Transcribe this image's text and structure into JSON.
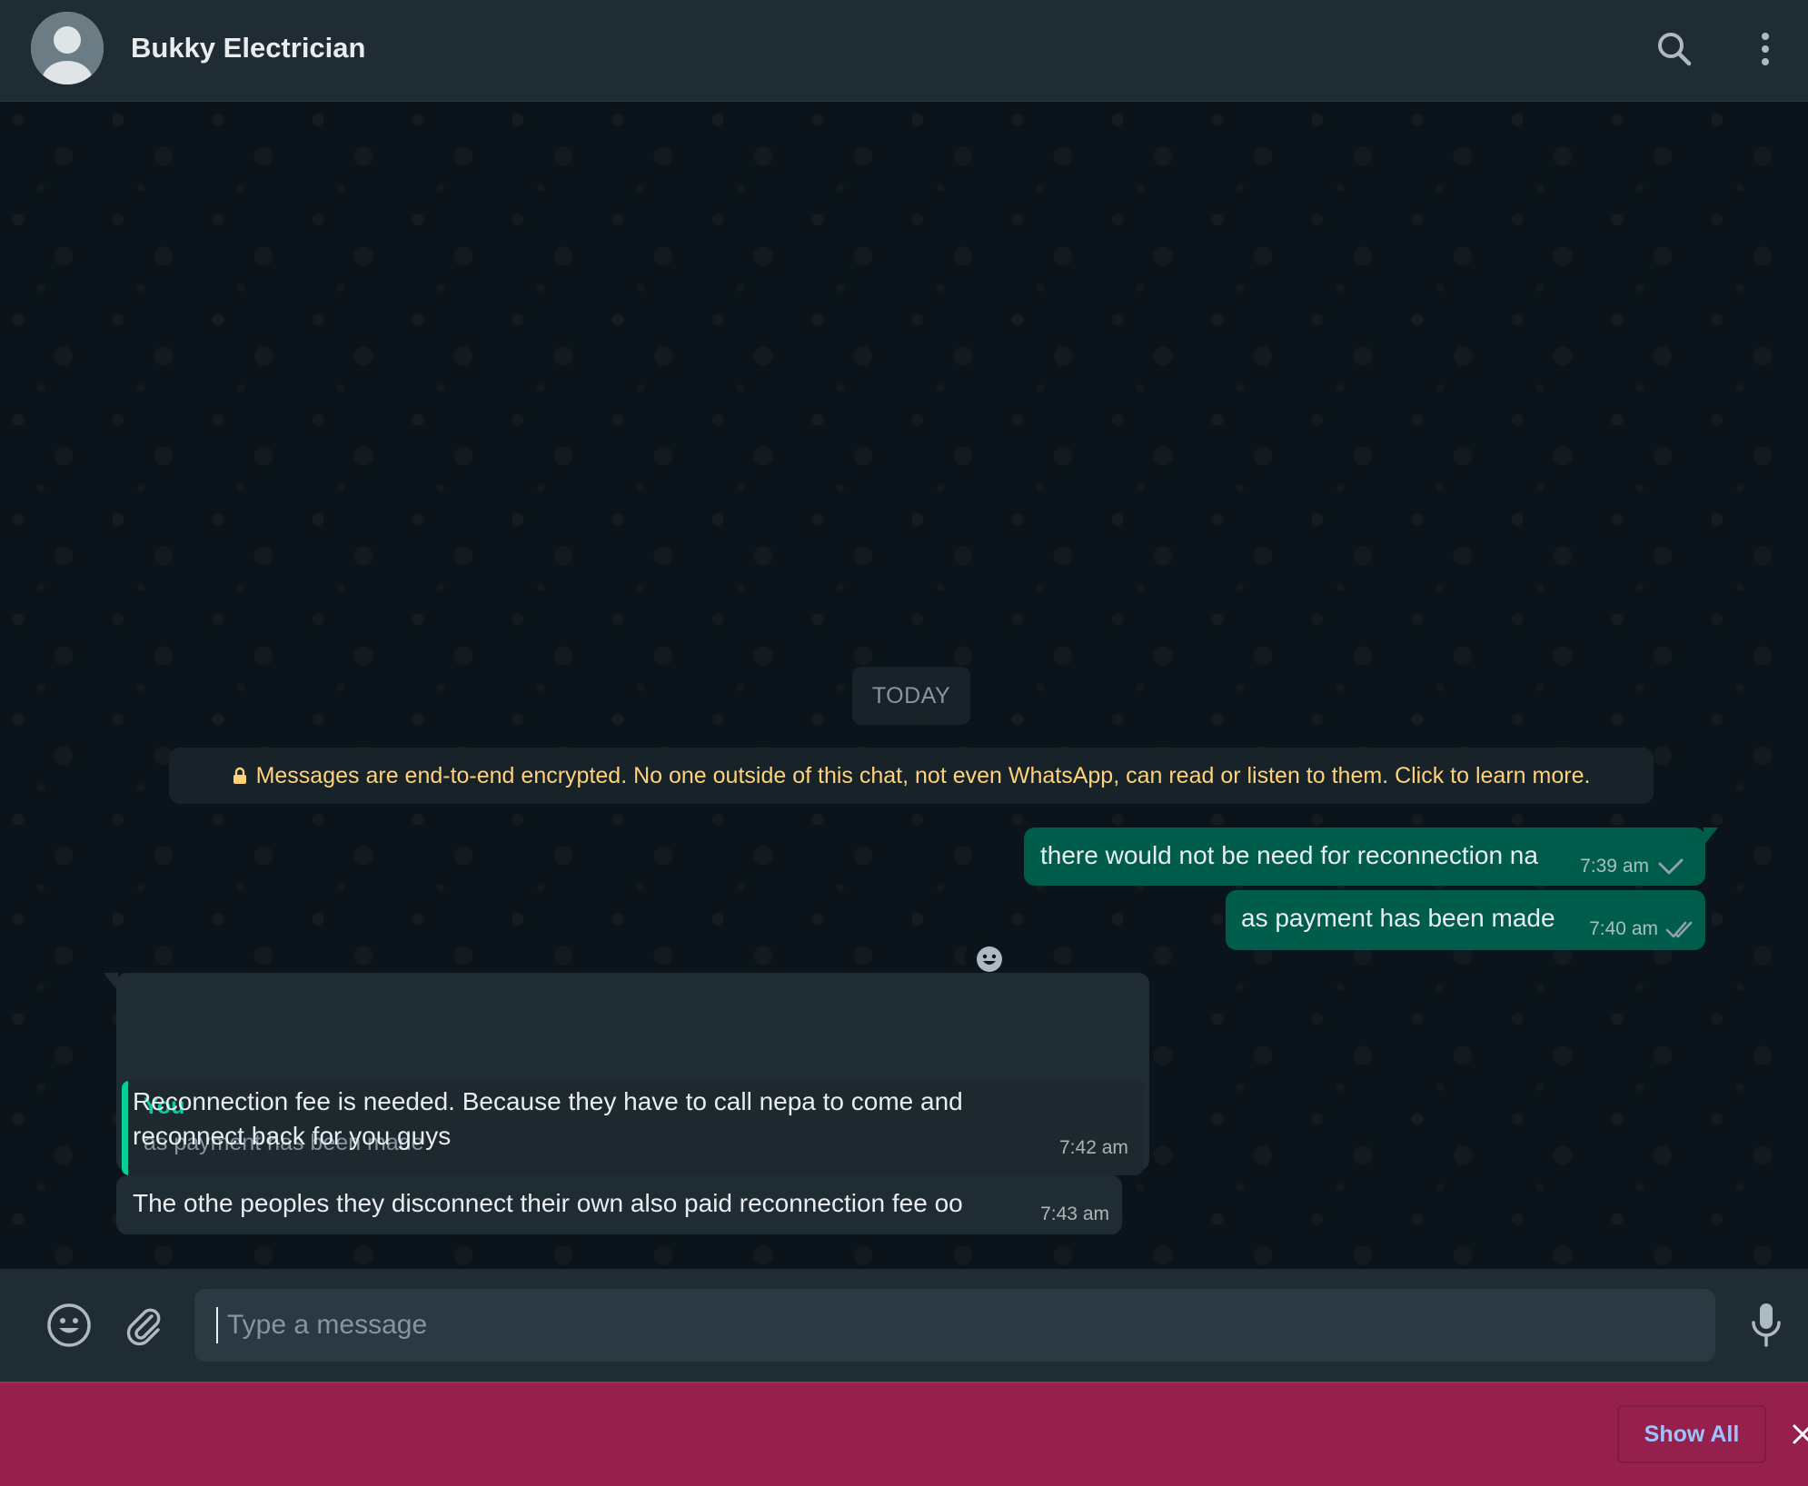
{
  "header": {
    "contact_name": "Bukky Electrician"
  },
  "chat": {
    "date_label": "TODAY",
    "encryption_notice": "Messages are end-to-end encrypted. No one outside of this chat, not even WhatsApp, can read or listen to them. Click to learn more.",
    "messages": [
      {
        "direction": "outgoing",
        "text": "there would not be need for reconnection na",
        "time": "7:39 am",
        "status": "sent"
      },
      {
        "direction": "outgoing",
        "text": "as payment has been made",
        "time": "7:40 am",
        "status": "delivered"
      },
      {
        "direction": "incoming",
        "quoted": {
          "author": "You",
          "text": "as payment has been made"
        },
        "lines": [
          "Reconnection fee is needed. Because  they have  to call nepa  to come and",
          "reconnect back for you guys"
        ],
        "time": "7:42 am"
      },
      {
        "direction": "incoming",
        "text": "The othe peoples they disconnect their  own also paid reconnection fee oo",
        "time": "7:43 am"
      }
    ]
  },
  "composer": {
    "placeholder": "Type a message"
  },
  "banner": {
    "show_all_label": "Show All"
  },
  "colors": {
    "header_bg": "#202c33",
    "chat_bg": "#0b141a",
    "outgoing_bubble": "#005c4b",
    "incoming_bubble": "#202c33",
    "encryption_text": "#ffd279",
    "quote_accent": "#06cf9c",
    "banner_bg": "#95204c",
    "show_all_text": "#9ec2ff"
  },
  "icons": {
    "avatar": "default-avatar-icon",
    "search": "search-icon",
    "menu": "more-vertical-icon",
    "lock": "lock-icon",
    "reaction": "emoji-react-icon",
    "sent": "single-check-icon",
    "delivered": "double-check-icon",
    "emoji": "emoji-icon",
    "attach": "paperclip-icon",
    "mic": "microphone-icon",
    "close": "close-icon"
  }
}
